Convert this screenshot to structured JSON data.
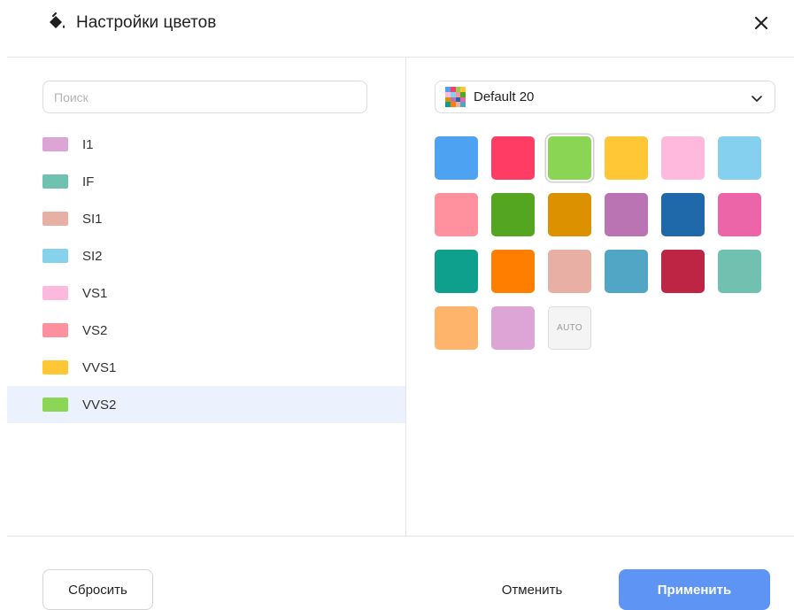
{
  "dialog": {
    "title": "Настройки цветов",
    "title_icon": "paint-bucket-icon",
    "close_icon": "close-icon"
  },
  "search": {
    "placeholder": "Поиск",
    "value": ""
  },
  "items": [
    {
      "label": "I1",
      "color": "#DDA4D6"
    },
    {
      "label": "IF",
      "color": "#70C1B0"
    },
    {
      "label": "SI1",
      "color": "#E8B0A4"
    },
    {
      "label": "SI2",
      "color": "#86D1EC"
    },
    {
      "label": "VS1",
      "color": "#FDB8DD"
    },
    {
      "label": "VS2",
      "color": "#FD909E"
    },
    {
      "label": "VVS1",
      "color": "#FFC636"
    },
    {
      "label": "VVS2",
      "color": "#8CD656"
    }
  ],
  "selected_item": "VVS2",
  "palette": {
    "name": "Default 20",
    "icon": "palette-icon",
    "dropdown_icon": "chevron-down-icon"
  },
  "colors": [
    "#4DA2F1",
    "#FF3D64",
    "#8AD554",
    "#FFC636",
    "#FFB9DD",
    "#84D0EE",
    "#FF909E",
    "#54A520",
    "#DB9100",
    "#BA74B3",
    "#1F68A9",
    "#ED65A9",
    "#0FA08D",
    "#FF7E00",
    "#E8B0A4",
    "#52A6C5",
    "#BE2443",
    "#70C1B0",
    "#FFB46C",
    "#DDA4D6"
  ],
  "selected_color": "#8AD554",
  "auto_label": "AUTO",
  "buttons": {
    "reset": "Сбросить",
    "cancel": "Отменить",
    "apply": "Применить"
  },
  "accent_color": "#5E95F5"
}
